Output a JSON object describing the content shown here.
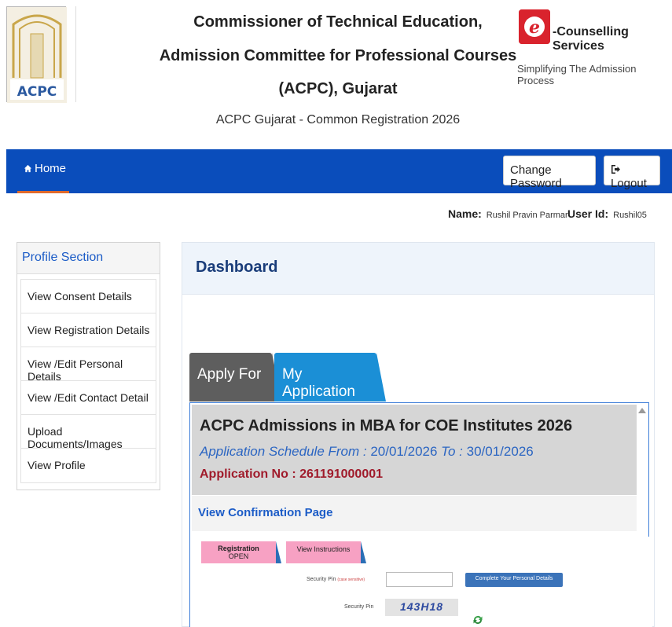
{
  "header": {
    "logo_text": "ACPC",
    "title_lines": [
      "Commissioner of Technical Education,",
      "Admission Committee for Professional Courses",
      "(ACPC), Gujarat"
    ],
    "subtitle": "ACPC Gujarat - Common Registration 2026",
    "ecounselling_label": "-Counselling Services",
    "ecounselling_tagline": "Simplifying The Admission Process"
  },
  "navbar": {
    "home_label": "Home",
    "change_password_label": "Change Password",
    "logout_label": "Logout"
  },
  "user": {
    "name_label": "Name:",
    "name_value": "Rushil Pravin Parmar",
    "id_label": "User Id:",
    "id_value": "Rushil05"
  },
  "sidebar": {
    "title": "Profile Section",
    "items": [
      {
        "label": "View Consent Details"
      },
      {
        "label": "View Registration Details"
      },
      {
        "label": "View /Edit Personal Details"
      },
      {
        "label": "View /Edit Contact Detail"
      },
      {
        "label": "Upload Documents/Images"
      },
      {
        "label": "View Profile"
      }
    ]
  },
  "dashboard": {
    "title": "Dashboard",
    "tabs": {
      "apply_for": "Apply For",
      "my_application": "My Application"
    },
    "application": {
      "title": "ACPC Admissions in MBA for COE Institutes 2026",
      "schedule_prefix": "Application Schedule From :",
      "from_date": "20/01/2026",
      "to_label": "To :",
      "to_date": "30/01/2026",
      "number_label": "Application No :",
      "number_value": "261191000001",
      "view_confirmation": "View Confirmation Page"
    }
  },
  "lower_strip": {
    "registration_tab": "Registration",
    "registration_status": "OPEN",
    "instructions_tab": "View Instructions",
    "security_pin_label": "Security Pin",
    "security_pin_note": "(case sensitive)",
    "complete_button": "Complete Your Personal Details",
    "security_pin_label2": "Security Pin",
    "captcha": "143H18"
  },
  "colors": {
    "navbar": "#0a4dbb",
    "tab_apply": "#5e5e5e",
    "tab_myapp": "#1b8fd6",
    "app_number": "#a01b2b",
    "link_blue": "#1c5cc7",
    "mini_tab_pink": "#f7a1c3"
  }
}
